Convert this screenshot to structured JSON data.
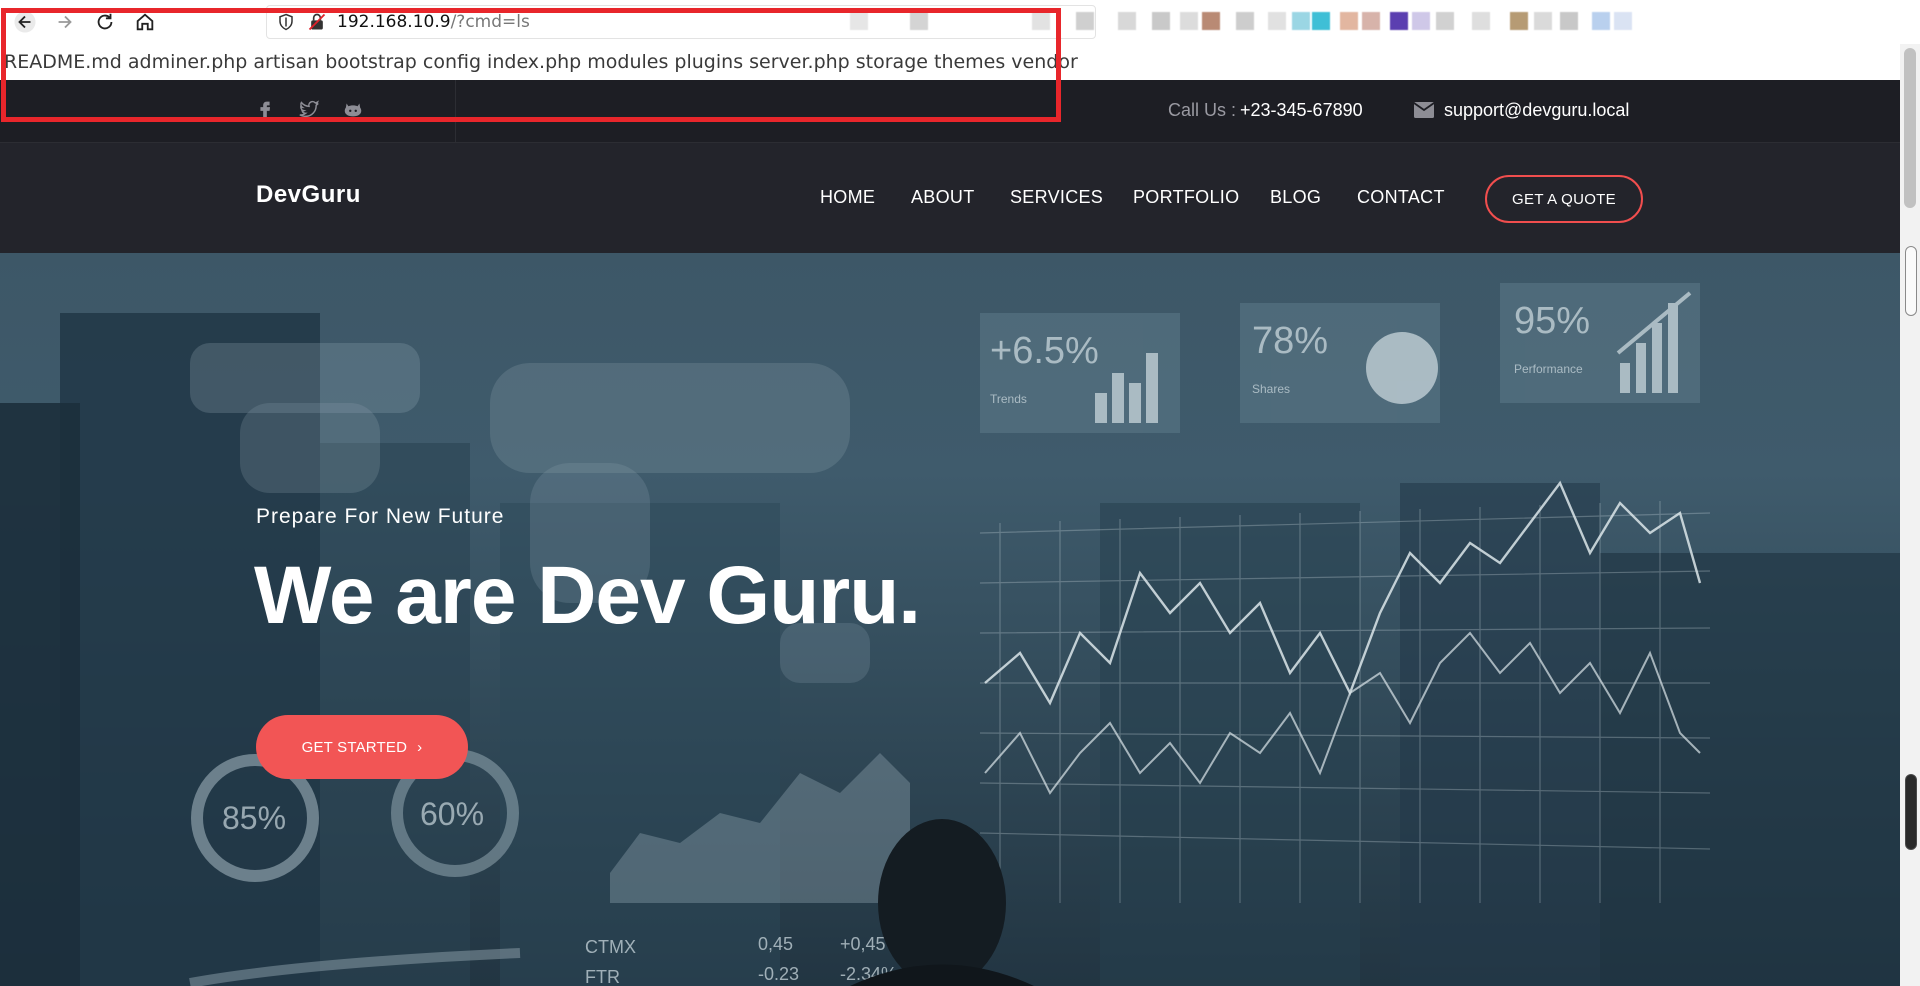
{
  "browser": {
    "url_host": "192.168.10.9",
    "url_path": "/?cmd=ls"
  },
  "command_output": "README.md adminer.php artisan bootstrap config index.php modules plugins server.php storage themes vendor",
  "topbar": {
    "call_label": "Call Us :",
    "call_number": "+23-345-67890",
    "email": "support@devguru.local"
  },
  "nav": {
    "brand": "DevGuru",
    "items": [
      {
        "label": "HOME"
      },
      {
        "label": "ABOUT"
      },
      {
        "label": "SERVICES"
      },
      {
        "label": "PORTFOLIO"
      },
      {
        "label": "BLOG"
      },
      {
        "label": "CONTACT"
      }
    ],
    "cta": "GET A QUOTE"
  },
  "hero": {
    "subtitle": "Prepare For New Future",
    "title": "We are Dev Guru.",
    "button": "GET STARTED",
    "bg_panels": {
      "trends": "+6.5%",
      "trends_label": "Trends",
      "shares": "78%",
      "shares_label": "Shares",
      "performance": "95%",
      "performance_label": "Performance",
      "gauge1": "85%",
      "gauge2": "60%",
      "ticker1": "CTMX",
      "ticker1_val": "0,45",
      "ticker1_change": "+0,45",
      "ticker2": "FTR",
      "ticker2_val": "-0.23",
      "ticker2_change": "-2.34%"
    }
  },
  "colors": {
    "accent": "#f25555",
    "topbar_bg": "#1d1e24",
    "nav_bg": "#23242b",
    "annotation": "#e8262b"
  },
  "icons": [
    "back-arrow-icon",
    "forward-arrow-icon",
    "reload-icon",
    "home-icon",
    "shield-icon",
    "insecure-lock-icon",
    "facebook-icon",
    "twitter-icon",
    "github-icon",
    "envelope-icon",
    "chevron-right-icon"
  ]
}
